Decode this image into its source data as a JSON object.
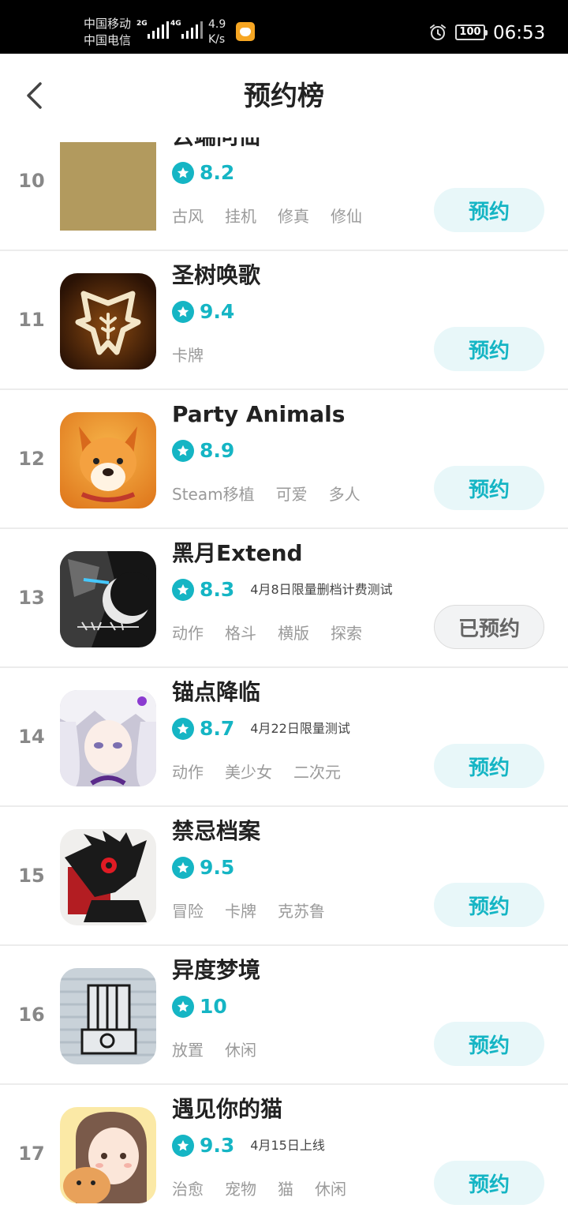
{
  "status_bar": {
    "carrier_1": "中国移动",
    "carrier_2": "中国电信",
    "sig1_label": "2G",
    "sig2_label": "4G",
    "net_speed_value": "4.9",
    "net_speed_unit": "K/s",
    "battery": "100",
    "time": "06:53"
  },
  "header": {
    "title": "预约榜"
  },
  "colors": {
    "accent": "#15b5c4",
    "button_bg": "#e8f7f9"
  },
  "list": [
    {
      "rank": "10",
      "name": "云端问仙",
      "score": "8.2",
      "note": "",
      "tags": [
        "古风",
        "挂机",
        "修真",
        "修仙"
      ],
      "button": "预约",
      "reserved": false,
      "icon": "yunduan-wenxian-icon"
    },
    {
      "rank": "11",
      "name": "圣树唤歌",
      "score": "9.4",
      "note": "",
      "tags": [
        "卡牌"
      ],
      "button": "预约",
      "reserved": false,
      "icon": "shengshu-huange-icon"
    },
    {
      "rank": "12",
      "name": "Party Animals",
      "score": "8.9",
      "note": "",
      "tags": [
        "Steam移植",
        "可爱",
        "多人"
      ],
      "button": "预约",
      "reserved": false,
      "icon": "party-animals-icon"
    },
    {
      "rank": "13",
      "name": "黑月Extend",
      "score": "8.3",
      "note": "4月8日限量删档计费测试",
      "tags": [
        "动作",
        "格斗",
        "横版",
        "探索"
      ],
      "button": "已预约",
      "reserved": true,
      "icon": "heiyue-extend-icon"
    },
    {
      "rank": "14",
      "name": "锚点降临",
      "score": "8.7",
      "note": "4月22日限量测试",
      "tags": [
        "动作",
        "美少女",
        "二次元"
      ],
      "button": "预约",
      "reserved": false,
      "icon": "maodian-jianglin-icon"
    },
    {
      "rank": "15",
      "name": "禁忌档案",
      "score": "9.5",
      "note": "",
      "tags": [
        "冒险",
        "卡牌",
        "克苏鲁"
      ],
      "button": "预约",
      "reserved": false,
      "icon": "jinji-dangan-icon"
    },
    {
      "rank": "16",
      "name": "异度梦境",
      "score": "10",
      "note": "",
      "tags": [
        "放置",
        "休闲"
      ],
      "button": "预约",
      "reserved": false,
      "icon": "yidu-mengjing-icon"
    },
    {
      "rank": "17",
      "name": "遇见你的猫",
      "score": "9.3",
      "note": "4月15日上线",
      "tags": [
        "治愈",
        "宠物",
        "猫",
        "休闲"
      ],
      "button": "预约",
      "reserved": false,
      "icon": "yujian-nide-mao-icon"
    }
  ]
}
